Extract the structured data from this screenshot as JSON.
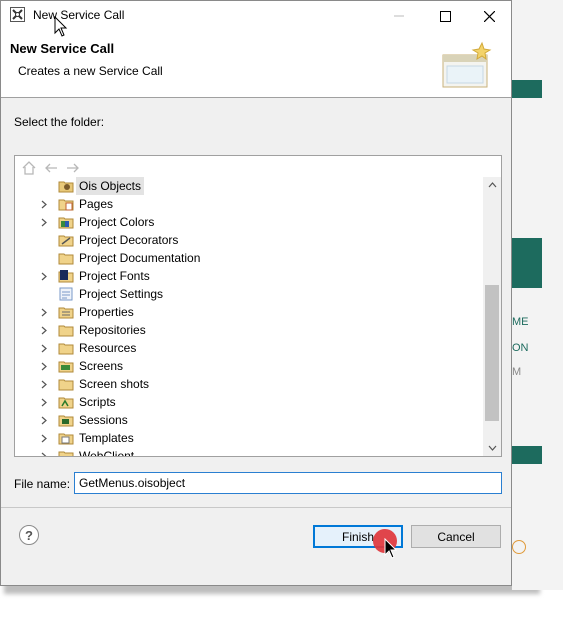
{
  "window": {
    "title": "New Service Call",
    "minimize_icon": "minimize-icon",
    "maximize_icon": "maximize-icon",
    "close_icon": "close-icon"
  },
  "header": {
    "title": "New Service Call",
    "description": "Creates a new Service Call"
  },
  "folder_section": {
    "label": "Select the folder:",
    "toolbar_icons": [
      "home-icon",
      "back-arrow-icon",
      "forward-arrow-icon"
    ]
  },
  "tree": {
    "items": [
      {
        "label": "Ois Objects",
        "expandable": false,
        "icon": "ois-objects-folder-icon",
        "selected": true
      },
      {
        "label": "Pages",
        "expandable": true,
        "icon": "pages-folder-icon"
      },
      {
        "label": "Project Colors",
        "expandable": true,
        "icon": "colors-folder-icon"
      },
      {
        "label": "Project Decorators",
        "expandable": false,
        "icon": "decorators-folder-icon"
      },
      {
        "label": "Project Documentation",
        "expandable": false,
        "icon": "folder-icon"
      },
      {
        "label": "Project Fonts",
        "expandable": true,
        "icon": "fonts-folder-icon"
      },
      {
        "label": "Project Settings",
        "expandable": false,
        "icon": "settings-icon"
      },
      {
        "label": "Properties",
        "expandable": true,
        "icon": "properties-folder-icon"
      },
      {
        "label": "Repositories",
        "expandable": true,
        "icon": "folder-icon"
      },
      {
        "label": "Resources",
        "expandable": true,
        "icon": "folder-icon"
      },
      {
        "label": "Screens",
        "expandable": true,
        "icon": "screens-folder-icon"
      },
      {
        "label": "Screen shots",
        "expandable": true,
        "icon": "folder-icon"
      },
      {
        "label": "Scripts",
        "expandable": true,
        "icon": "scripts-folder-icon"
      },
      {
        "label": "Sessions",
        "expandable": true,
        "icon": "sessions-folder-icon"
      },
      {
        "label": "Templates",
        "expandable": true,
        "icon": "templates-folder-icon"
      },
      {
        "label": "WebClient",
        "expandable": true,
        "icon": "folder-icon"
      }
    ]
  },
  "file_name": {
    "label": "File name:",
    "value": "GetMenus.oisobject"
  },
  "buttons": {
    "finish": "Finish",
    "cancel": "Cancel",
    "help": "?"
  },
  "background_app": {
    "text_1": "ME",
    "text_2": "ON",
    "text_3": "M"
  },
  "colors": {
    "accent": "#0078d7",
    "band": "#1d6b5e",
    "cursor_highlight": "#e0363c"
  }
}
